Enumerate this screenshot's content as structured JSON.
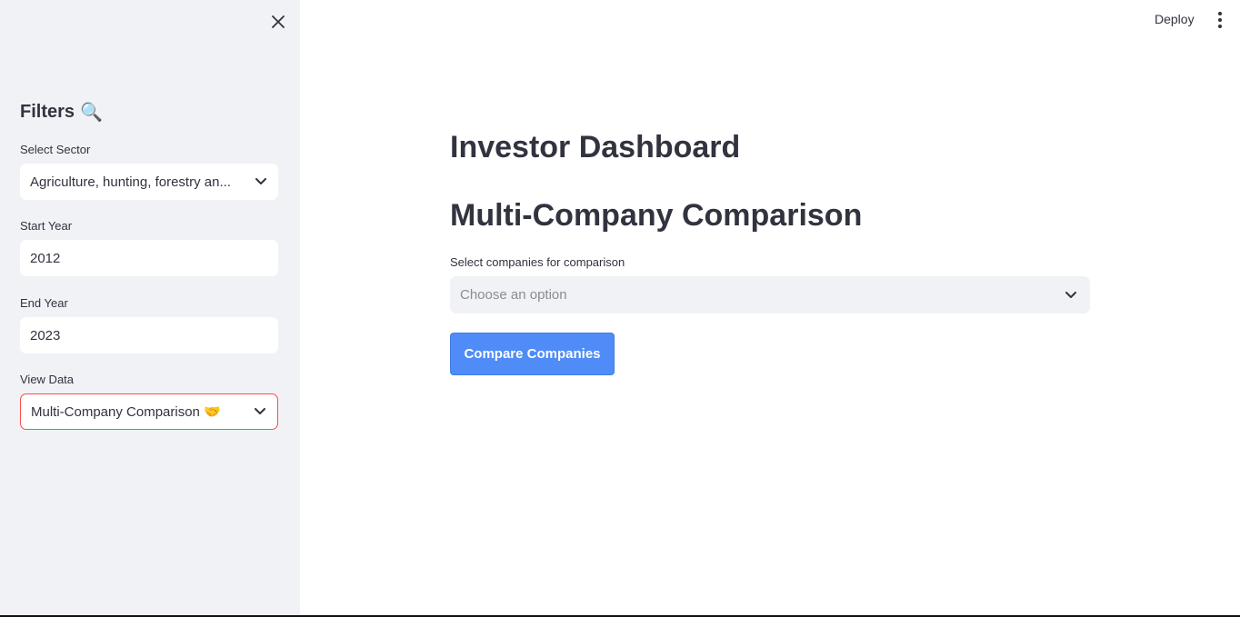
{
  "header": {
    "deploy_label": "Deploy"
  },
  "sidebar": {
    "title": "Filters",
    "title_emoji": "🔍",
    "sector_label": "Select Sector",
    "sector_value": "Agriculture, hunting, forestry an...",
    "start_year_label": "Start Year",
    "start_year_value": "2012",
    "end_year_label": "End Year",
    "end_year_value": "2023",
    "view_data_label": "View Data",
    "view_data_value": "Multi-Company Comparison 🤝"
  },
  "main": {
    "title": "Investor Dashboard",
    "subtitle": "Multi-Company Comparison",
    "companies_label": "Select companies for comparison",
    "companies_placeholder": "Choose an option",
    "compare_button": "Compare Companies"
  },
  "colors": {
    "sidebar_bg": "#f0f2f6",
    "accent": "#ff4b4b",
    "primary_button": "#4f8cf7",
    "text": "#31333f"
  },
  "icons": {
    "close": "close-icon",
    "chevron": "chevron-down-icon",
    "menu": "kebab-menu-icon"
  }
}
